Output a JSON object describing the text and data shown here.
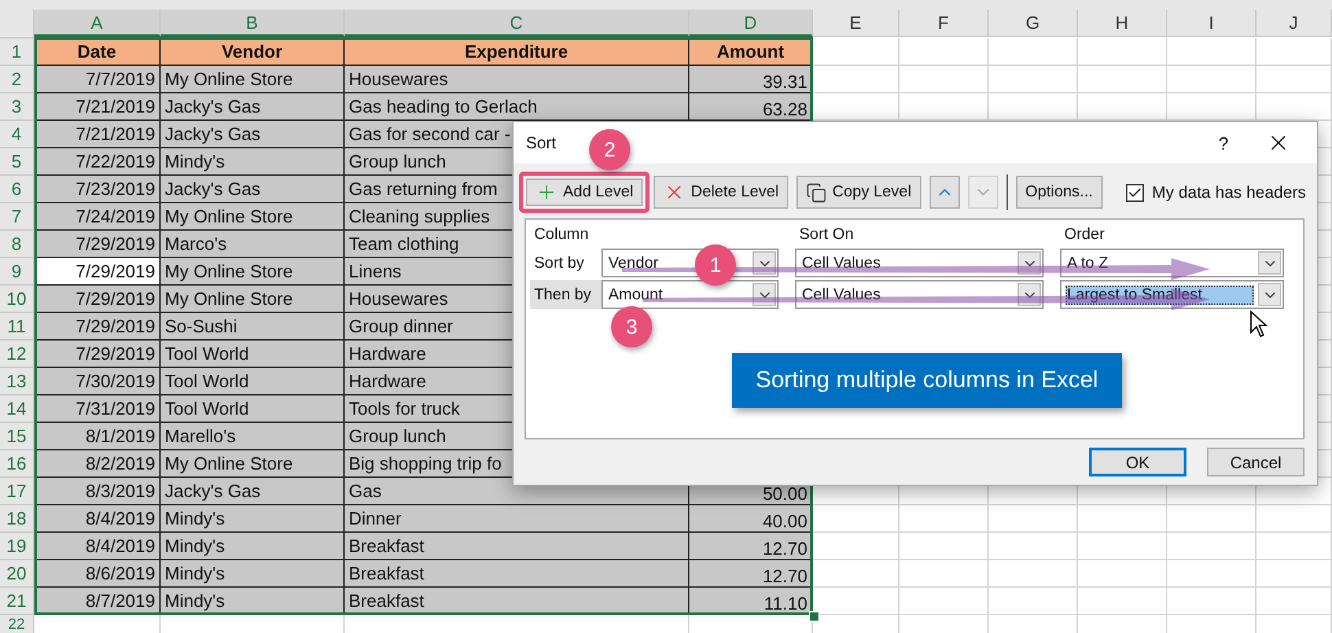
{
  "sheet": {
    "columns": [
      "A",
      "B",
      "C",
      "D",
      "E",
      "F",
      "G",
      "H",
      "I",
      "J"
    ],
    "header": {
      "number": "1",
      "cells": [
        "Date",
        "Vendor",
        "Expenditure",
        "Amount"
      ]
    },
    "rows": [
      {
        "number": "2",
        "date": "7/7/2019",
        "vendor": "My Online Store",
        "expenditure": "Housewares",
        "amount": "39.31",
        "active": false
      },
      {
        "number": "3",
        "date": "7/21/2019",
        "vendor": "Jacky's Gas",
        "expenditure": "Gas heading to Gerlach",
        "amount": "63.28",
        "active": false
      },
      {
        "number": "4",
        "date": "7/21/2019",
        "vendor": "Jacky's Gas",
        "expenditure": "Gas for second car -",
        "active": false
      },
      {
        "number": "5",
        "date": "7/22/2019",
        "vendor": "Mindy's",
        "expenditure": "Group lunch",
        "active": false
      },
      {
        "number": "6",
        "date": "7/23/2019",
        "vendor": "Jacky's Gas",
        "expenditure": "Gas returning from",
        "active": false
      },
      {
        "number": "7",
        "date": "7/24/2019",
        "vendor": "My Online Store",
        "expenditure": "Cleaning supplies",
        "active": false
      },
      {
        "number": "8",
        "date": "7/29/2019",
        "vendor": "Marco's",
        "expenditure": "Team clothing",
        "active": false
      },
      {
        "number": "9",
        "date": "7/29/2019",
        "vendor": "My Online Store",
        "expenditure": "Linens",
        "active": true
      },
      {
        "number": "10",
        "date": "7/29/2019",
        "vendor": "My Online Store",
        "expenditure": "Housewares",
        "active": false
      },
      {
        "number": "11",
        "date": "7/29/2019",
        "vendor": "So-Sushi",
        "expenditure": "Group dinner",
        "active": false
      },
      {
        "number": "12",
        "date": "7/29/2019",
        "vendor": "Tool World",
        "expenditure": "Hardware",
        "active": false
      },
      {
        "number": "13",
        "date": "7/30/2019",
        "vendor": "Tool World",
        "expenditure": "Hardware",
        "active": false
      },
      {
        "number": "14",
        "date": "7/31/2019",
        "vendor": "Tool World",
        "expenditure": "Tools for truck",
        "active": false
      },
      {
        "number": "15",
        "date": "8/1/2019",
        "vendor": "Marello's",
        "expenditure": "Group lunch",
        "active": false
      },
      {
        "number": "16",
        "date": "8/2/2019",
        "vendor": "My Online Store",
        "expenditure": "Big shopping trip fo",
        "active": false
      },
      {
        "number": "17",
        "date": "8/3/2019",
        "vendor": "Jacky's Gas",
        "expenditure": "Gas",
        "amount": "50.00",
        "active": false
      },
      {
        "number": "18",
        "date": "8/4/2019",
        "vendor": "Mindy's",
        "expenditure": "Dinner",
        "amount": "40.00",
        "active": false
      },
      {
        "number": "19",
        "date": "8/4/2019",
        "vendor": "Mindy's",
        "expenditure": "Breakfast",
        "amount": "12.70",
        "active": false
      },
      {
        "number": "20",
        "date": "8/6/2019",
        "vendor": "Mindy's",
        "expenditure": "Breakfast",
        "amount": "12.70",
        "active": false
      },
      {
        "number": "21",
        "date": "8/7/2019",
        "vendor": "Mindy's",
        "expenditure": "Breakfast",
        "amount": "11.10",
        "active": false
      }
    ],
    "empty_rows": [
      "22"
    ]
  },
  "dialog": {
    "title": "Sort",
    "help": "?",
    "toolbar": [
      {
        "kind": "add",
        "label": "Add Level",
        "highlighted": true
      },
      {
        "kind": "delete",
        "label": "Delete Level",
        "highlighted": false
      },
      {
        "kind": "copy",
        "label": "Copy Level",
        "highlighted": false
      },
      {
        "kind": "up",
        "disabled": false
      },
      {
        "kind": "down",
        "disabled": true
      },
      {
        "kind": "options",
        "label": "Options...",
        "highlighted": false
      }
    ],
    "headers_checkbox": {
      "label": "My data has headers",
      "checked": true
    },
    "grid_headers": [
      "Column",
      "Sort On",
      "Order"
    ],
    "levels": [
      {
        "label": "Sort by",
        "column": "Vendor",
        "sort_on": "Cell Values",
        "order": "A to Z",
        "selected": false
      },
      {
        "label": "Then by",
        "column": "Amount",
        "sort_on": "Cell Values",
        "order": "Largest to Smallest",
        "selected": true
      }
    ],
    "caption": "Sorting multiple columns in Excel",
    "steps": [
      "1",
      "2",
      "3"
    ],
    "buttons": [
      {
        "label": "OK",
        "default": true
      },
      {
        "label": "Cancel",
        "default": false
      }
    ]
  }
}
